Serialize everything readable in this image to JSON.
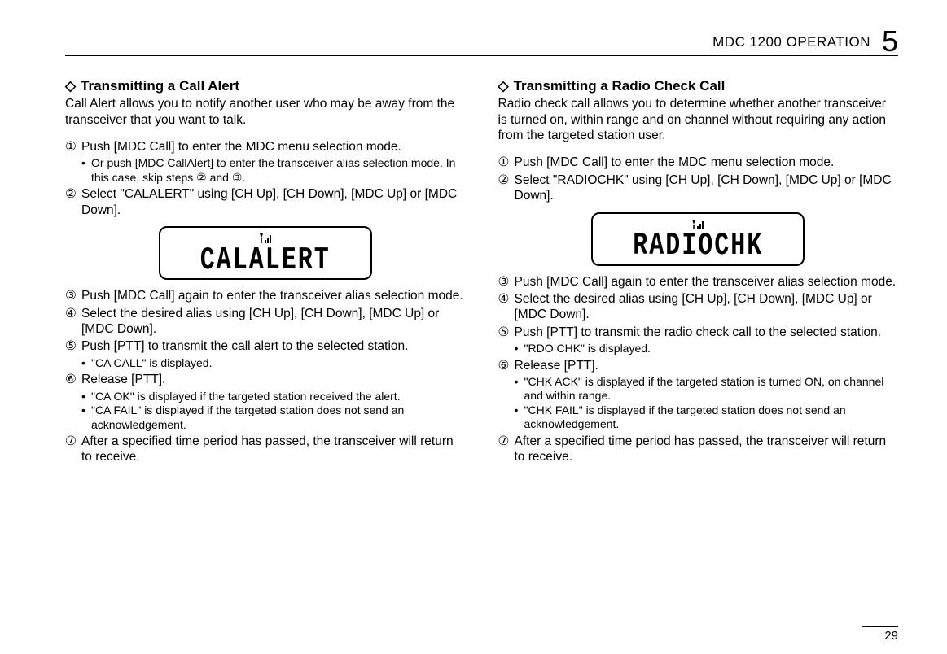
{
  "header": {
    "chapter_title": "MDC 1200 OPERATION",
    "chapter_number": "5"
  },
  "page_number": "29",
  "diamond_glyph": "◇",
  "left": {
    "title": "Transmitting a Call Alert",
    "intro": "Call Alert allows you to notify another user who may be away from the transceiver that you want to talk.",
    "lcd": "CALALERT",
    "steps": [
      {
        "marker": "①",
        "text": "Push [MDC Call] to enter the MDC menu selection mode.",
        "sub": [
          "Or push [MDC CallAlert] to enter the transceiver alias selection mode. In this case, skip steps ② and ③."
        ]
      },
      {
        "marker": "②",
        "text": "Select \"CALALERT\" using [CH Up], [CH Down], [MDC Up] or [MDC Down]."
      },
      {
        "marker": "③",
        "text": "Push [MDC Call] again to enter the transceiver alias selection mode."
      },
      {
        "marker": "④",
        "text": "Select the desired alias using [CH Up], [CH Down], [MDC Up] or [MDC Down]."
      },
      {
        "marker": "⑤",
        "text": "Push [PTT] to transmit the call alert to the selected station.",
        "sub": [
          "\"CA CALL\" is displayed."
        ]
      },
      {
        "marker": "⑥",
        "text": "Release [PTT].",
        "sub": [
          "\"CA OK\" is displayed if the targeted station received the alert.",
          "\"CA FAIL\" is displayed if the targeted station does not send an acknowledgement."
        ]
      },
      {
        "marker": "⑦",
        "text": "After a specified time period has passed, the transceiver will return to receive."
      }
    ]
  },
  "right": {
    "title": "Transmitting a Radio Check Call",
    "intro": "Radio check call allows you to determine whether another transceiver is turned on, within range and on channel without requiring any action from the targeted station user.",
    "lcd": "RADIOCHK",
    "steps": [
      {
        "marker": "①",
        "text": "Push [MDC Call] to enter the MDC menu selection mode."
      },
      {
        "marker": "②",
        "text": "Select \"RADIOCHK\" using [CH Up], [CH Down], [MDC Up] or [MDC Down]."
      },
      {
        "marker": "③",
        "text": "Push [MDC Call] again to enter the transceiver alias selection mode."
      },
      {
        "marker": "④",
        "text": "Select the desired alias using [CH Up], [CH Down], [MDC Up] or [MDC Down]."
      },
      {
        "marker": "⑤",
        "text": "Push [PTT] to transmit the radio check call to the selected station.",
        "sub": [
          "\"RDO CHK\" is displayed."
        ]
      },
      {
        "marker": "⑥",
        "text": "Release [PTT].",
        "sub": [
          "\"CHK ACK\" is displayed if the targeted station is turned ON, on channel and within range.",
          "\"CHK FAIL\" is displayed if the targeted station does not send an acknowledgement."
        ]
      },
      {
        "marker": "⑦",
        "text": "After a specified time period has passed, the transceiver will return to receive."
      }
    ]
  }
}
